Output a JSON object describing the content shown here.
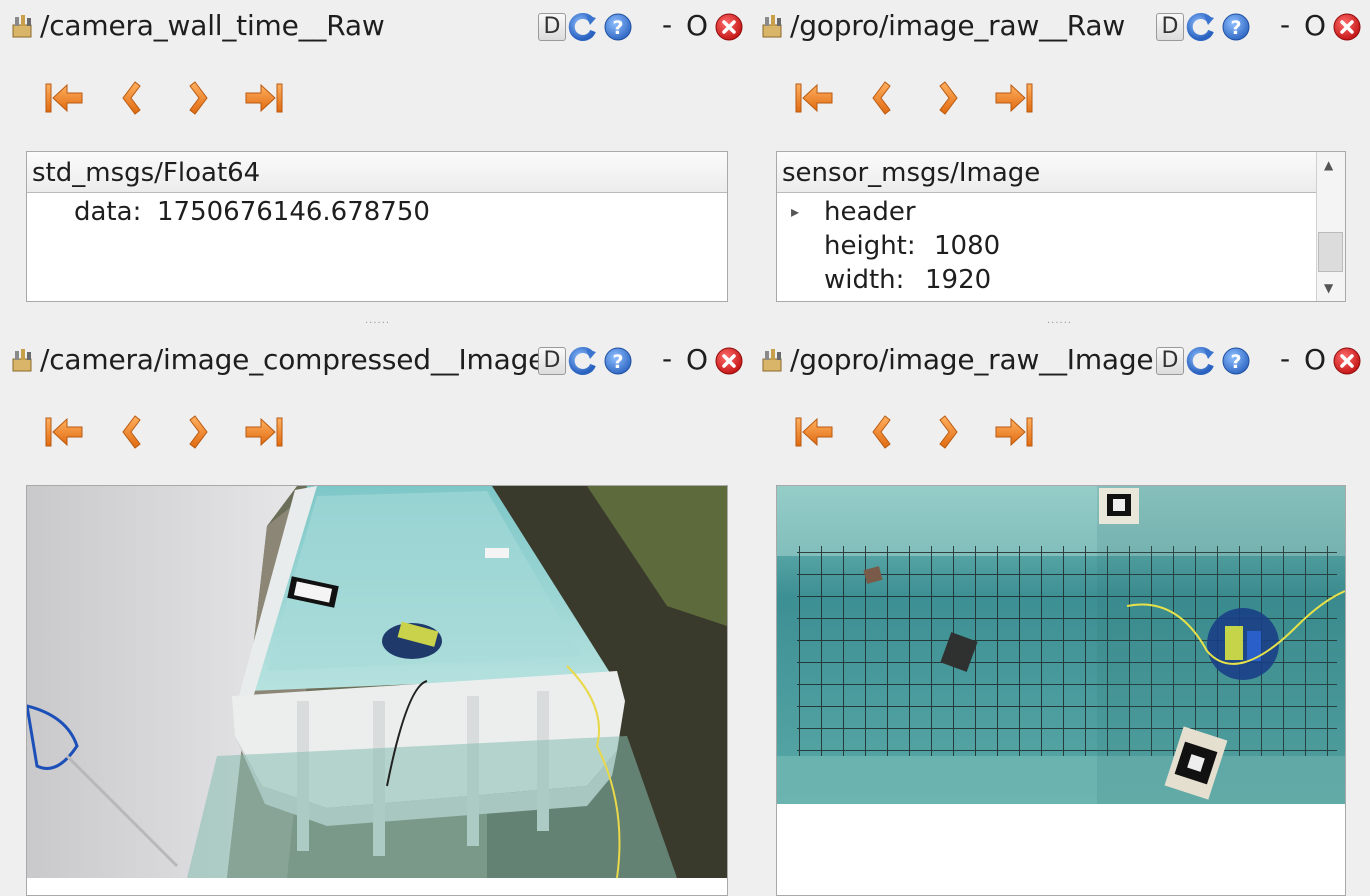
{
  "panels": {
    "top_left": {
      "title": "/camera_wall_time__Raw",
      "msg_type": "std_msgs/Float64",
      "rows": [
        {
          "key": "data:",
          "value": "1750676146.678750"
        }
      ]
    },
    "top_right": {
      "title": "/gopro/image_raw__Raw",
      "msg_type": "sensor_msgs/Image",
      "rows": [
        {
          "key": "header",
          "value": ""
        },
        {
          "key": "height:",
          "value": "1080"
        },
        {
          "key": "width:",
          "value": "1920"
        }
      ]
    },
    "bottom_left": {
      "title": "/camera/image_compressed__Image"
    },
    "bottom_right": {
      "title": "/gopro/image_raw__Image"
    }
  },
  "titlebar_buttons": {
    "d_label": "D",
    "minimize_label": "-",
    "float_label": "O"
  },
  "icons": {
    "plugin": "plugin-icon",
    "refresh": "refresh-icon",
    "help": "help-icon",
    "close": "close-icon",
    "first": "first-icon",
    "prev": "prev-icon",
    "next": "next-icon",
    "last": "last-icon"
  },
  "colors": {
    "nav_arrow": "#f08c2c",
    "close_red": "#e0282a",
    "help_blue": "#3e7fd6",
    "refresh_blue": "#4a86d8"
  }
}
